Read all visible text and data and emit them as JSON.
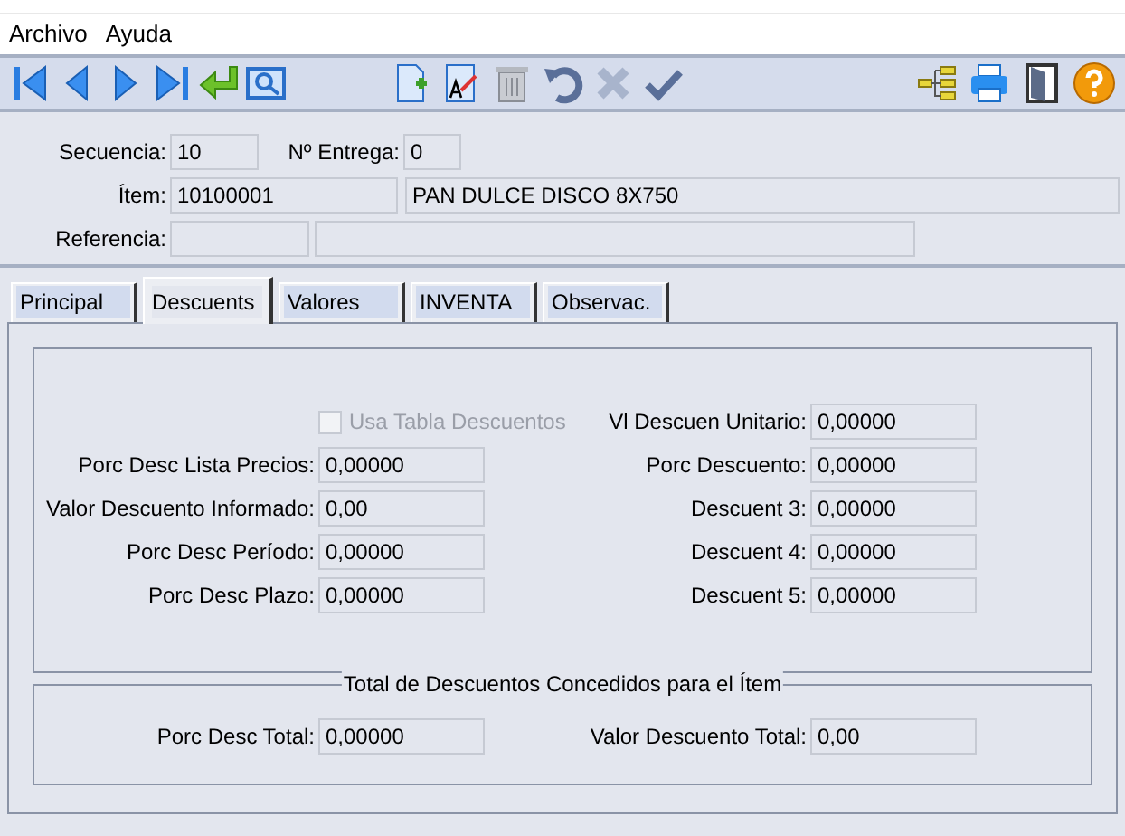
{
  "menu": [
    "Archivo",
    "Ayuda"
  ],
  "header": {
    "secuencia": {
      "label": "Secuencia:",
      "value": "10"
    },
    "entrega": {
      "label": "Nº Entrega:",
      "value": "0"
    },
    "item": {
      "label": "Ítem:",
      "code": "10100001",
      "description": "PAN DULCE DISCO 8X750"
    },
    "referencia": {
      "label": "Referencia:"
    }
  },
  "tabs": [
    {
      "label": "Principal",
      "selected": false
    },
    {
      "label": "Descuents",
      "selected": true
    },
    {
      "label": "Valores",
      "selected": false
    },
    {
      "label": "INVENTA",
      "selected": false
    },
    {
      "label": "Observac.",
      "selected": false
    }
  ],
  "left_fields": [
    {
      "kind": "checkbox",
      "label": "Usa Tabla Descuentos",
      "checked": false,
      "disabled": true
    },
    {
      "kind": "field",
      "label": "Porc Desc Lista Precios:",
      "value": "0,00000"
    },
    {
      "kind": "field",
      "label": "Valor Descuento Informado:",
      "value": "0,00"
    },
    {
      "kind": "field",
      "label": "Porc Desc Período:",
      "value": "0,00000"
    },
    {
      "kind": "field",
      "label": "Porc Desc Plazo:",
      "value": "0,00000"
    }
  ],
  "right_fields": [
    {
      "label": "Vl Descuen Unitario:",
      "value": "0,00000"
    },
    {
      "label": "Porc Descuento:",
      "value": "0,00000"
    },
    {
      "label": "Descuent 3:",
      "value": "0,00000"
    },
    {
      "label": "Descuent 4:",
      "value": "0,00000"
    },
    {
      "label": "Descuent 5:",
      "value": "0,00000"
    }
  ],
  "totals": {
    "title": "Total de Descuentos Concedidos para el Ítem",
    "fields": [
      {
        "label": "Porc Desc Total:",
        "value": "0,00000"
      },
      {
        "label": "Valor Descuento Total:",
        "value": "0,00"
      }
    ]
  }
}
